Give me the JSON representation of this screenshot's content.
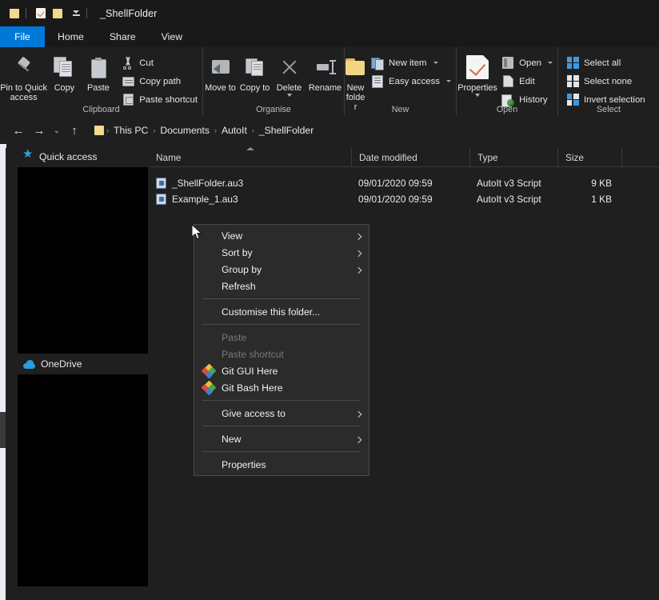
{
  "window": {
    "title": "_ShellFolder",
    "quick_access_toolbar": [
      {
        "name": "folder-properties",
        "icon": "folder-icon"
      },
      {
        "name": "properties",
        "icon": "properties-icon"
      },
      {
        "name": "new-folder",
        "icon": "new-folder-icon"
      },
      {
        "name": "customise-qat",
        "icon": "chevron-down-icon"
      }
    ]
  },
  "tabs": [
    {
      "label": "File",
      "active": true
    },
    {
      "label": "Home",
      "active": false
    },
    {
      "label": "Share",
      "active": false
    },
    {
      "label": "View",
      "active": false
    }
  ],
  "ribbon": {
    "groups": [
      {
        "label": "Clipboard",
        "big": [
          {
            "label": "Pin to Quick access",
            "icon": "pin-icon"
          },
          {
            "label": "Copy",
            "icon": "copy-icon"
          },
          {
            "label": "Paste",
            "icon": "paste-icon"
          }
        ],
        "small": [
          {
            "label": "Cut",
            "icon": "scissors-icon"
          },
          {
            "label": "Copy path",
            "icon": "copy-path-icon"
          },
          {
            "label": "Paste shortcut",
            "icon": "paste-shortcut-icon"
          }
        ]
      },
      {
        "label": "Organise",
        "big": [
          {
            "label": "Move to",
            "icon": "move-to-icon",
            "caret": true
          },
          {
            "label": "Copy to",
            "icon": "copy-to-icon",
            "caret": true
          },
          {
            "label": "Delete",
            "icon": "delete-icon",
            "caret": true
          },
          {
            "label": "Rename",
            "icon": "rename-icon"
          }
        ],
        "small": []
      },
      {
        "label": "New",
        "big": [
          {
            "label": "New folder",
            "icon": "new-folder-icon"
          }
        ],
        "small": [
          {
            "label": "New item",
            "icon": "new-item-icon",
            "caret": true
          },
          {
            "label": "Easy access",
            "icon": "easy-access-icon",
            "caret": true
          }
        ]
      },
      {
        "label": "Open",
        "big": [
          {
            "label": "Properties",
            "icon": "properties-icon",
            "caret": true
          }
        ],
        "small": [
          {
            "label": "Open",
            "icon": "open-icon",
            "caret": true
          },
          {
            "label": "Edit",
            "icon": "edit-icon"
          },
          {
            "label": "History",
            "icon": "history-icon"
          }
        ]
      },
      {
        "label": "Select",
        "big": [],
        "small": [
          {
            "label": "Select all",
            "icon": "select-all-icon"
          },
          {
            "label": "Select none",
            "icon": "select-none-icon"
          },
          {
            "label": "Invert selection",
            "icon": "invert-selection-icon"
          }
        ]
      }
    ]
  },
  "address_bar": {
    "back": "←",
    "forward": "→",
    "recent": "⌄",
    "up": "↑",
    "separator": "›",
    "breadcrumb": [
      "This PC",
      "Documents",
      "AutoIt",
      "_ShellFolder"
    ]
  },
  "sidebar": {
    "items": [
      {
        "label": "Quick access",
        "icon": "star-icon"
      },
      {
        "label": "OneDrive",
        "icon": "onedrive-cloud-icon"
      }
    ]
  },
  "file_list": {
    "columns": [
      {
        "label": "Name",
        "sorted": "asc"
      },
      {
        "label": "Date modified",
        "sorted": ""
      },
      {
        "label": "Type",
        "sorted": ""
      },
      {
        "label": "Size",
        "sorted": ""
      }
    ],
    "rows": [
      {
        "name": "_ShellFolder.au3",
        "date": "09/01/2020 09:59",
        "type": "AutoIt v3 Script",
        "size": "9 KB",
        "icon": "au3-script-icon"
      },
      {
        "name": "Example_1.au3",
        "date": "09/01/2020 09:59",
        "type": "AutoIt v3 Script",
        "size": "1 KB",
        "icon": "au3-script-icon"
      }
    ]
  },
  "context_menu": {
    "items": [
      {
        "label": "View",
        "submenu": true,
        "disabled": false,
        "icon": ""
      },
      {
        "label": "Sort by",
        "submenu": true,
        "disabled": false,
        "icon": ""
      },
      {
        "label": "Group by",
        "submenu": true,
        "disabled": false,
        "icon": ""
      },
      {
        "label": "Refresh",
        "submenu": false,
        "disabled": false,
        "icon": ""
      },
      {
        "separator": true
      },
      {
        "label": "Customise this folder...",
        "submenu": false,
        "disabled": false,
        "icon": ""
      },
      {
        "separator": true
      },
      {
        "label": "Paste",
        "submenu": false,
        "disabled": true,
        "icon": ""
      },
      {
        "label": "Paste shortcut",
        "submenu": false,
        "disabled": true,
        "icon": ""
      },
      {
        "label": "Git GUI Here",
        "submenu": false,
        "disabled": false,
        "icon": "git-icon"
      },
      {
        "label": "Git Bash Here",
        "submenu": false,
        "disabled": false,
        "icon": "git-icon"
      },
      {
        "separator": true
      },
      {
        "label": "Give access to",
        "submenu": true,
        "disabled": false,
        "icon": ""
      },
      {
        "separator": true
      },
      {
        "label": "New",
        "submenu": true,
        "disabled": false,
        "icon": ""
      },
      {
        "separator": true
      },
      {
        "label": "Properties",
        "submenu": false,
        "disabled": false,
        "icon": ""
      }
    ]
  },
  "colors": {
    "accent": "#0078d7",
    "window_bg": "#1f1f1f",
    "titlebar_bg": "#191919",
    "menu_bg": "#2b2b2b",
    "text": "#eaeaea",
    "disabled_text": "#7a7a7a",
    "folder_yellow": "#f3d98d"
  }
}
